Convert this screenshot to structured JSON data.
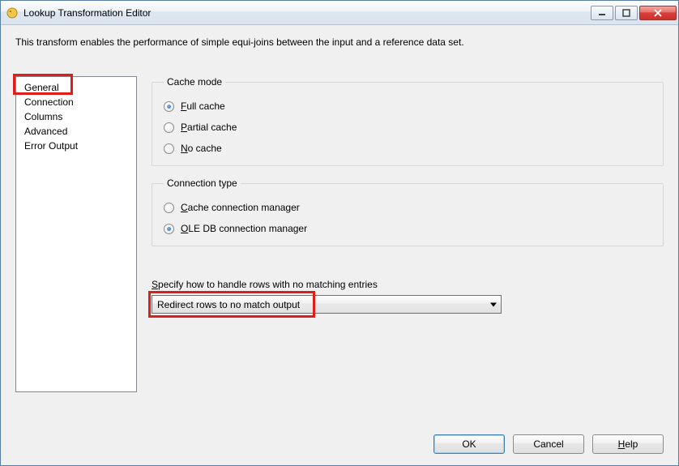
{
  "window": {
    "title": "Lookup Transformation Editor"
  },
  "description": "This transform enables the performance of simple equi-joins between the input and a reference data set.",
  "sidebar": {
    "items": [
      {
        "label": "General"
      },
      {
        "label": "Connection"
      },
      {
        "label": "Columns"
      },
      {
        "label": "Advanced"
      },
      {
        "label": "Error Output"
      }
    ]
  },
  "cache_mode": {
    "legend": "Cache mode",
    "options": [
      {
        "access": "F",
        "rest": "ull cache",
        "checked": true
      },
      {
        "access": "P",
        "rest": "artial cache",
        "checked": false
      },
      {
        "access": "N",
        "rest": "o cache",
        "checked": false
      }
    ]
  },
  "connection_type": {
    "legend": "Connection type",
    "options": [
      {
        "access": "C",
        "rest": "ache connection manager",
        "checked": false
      },
      {
        "access": "O",
        "rest": "LE DB connection manager",
        "checked": true
      }
    ]
  },
  "specify": {
    "label_access": "S",
    "label_rest": "pecify how to handle rows with no matching entries",
    "selected": "Redirect rows to no match output"
  },
  "buttons": {
    "ok": "OK",
    "cancel": "Cancel",
    "help_access": "H",
    "help_rest": "elp"
  }
}
